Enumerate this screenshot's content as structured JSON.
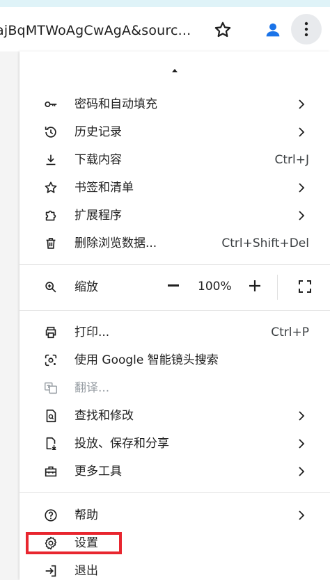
{
  "toolbar": {
    "url_text": "ajBqMTWoAgCwAgA&sourc...",
    "star_icon": "star-outline-icon",
    "profile_icon": "person-icon",
    "menu_icon": "three-dots-vertical-icon",
    "profile_color": "#1a73e8"
  },
  "menu": {
    "items": [
      {
        "label": "密码和自动填充",
        "icon": "key-icon",
        "shortcut": "",
        "has_submenu": true
      },
      {
        "label": "历史记录",
        "icon": "history-icon",
        "shortcut": "",
        "has_submenu": true
      },
      {
        "label": "下载内容",
        "icon": "download-icon",
        "shortcut": "Ctrl+J",
        "has_submenu": false
      },
      {
        "label": "书签和清单",
        "icon": "star-icon",
        "shortcut": "",
        "has_submenu": true
      },
      {
        "label": "扩展程序",
        "icon": "puzzle-icon",
        "shortcut": "",
        "has_submenu": true
      },
      {
        "label": "删除浏览数据...",
        "icon": "trash-icon",
        "shortcut": "Ctrl+Shift+Del",
        "has_submenu": false
      }
    ],
    "zoom": {
      "label": "缩放",
      "value": "100%",
      "icon": "zoom-icon"
    },
    "items2": [
      {
        "label": "打印...",
        "icon": "printer-icon",
        "shortcut": "Ctrl+P",
        "has_submenu": false
      },
      {
        "label": "使用 Google 智能镜头搜索",
        "icon": "lens-icon",
        "shortcut": "",
        "has_submenu": false
      },
      {
        "label": "翻译...",
        "icon": "translate-icon",
        "shortcut": "",
        "has_submenu": false,
        "disabled": true
      },
      {
        "label": "查找和修改",
        "icon": "find-icon",
        "shortcut": "",
        "has_submenu": true
      },
      {
        "label": "投放、保存和分享",
        "icon": "cast-save-icon",
        "shortcut": "",
        "has_submenu": true
      },
      {
        "label": "更多工具",
        "icon": "toolbox-icon",
        "shortcut": "",
        "has_submenu": true
      }
    ],
    "items3": [
      {
        "label": "帮助",
        "icon": "help-icon",
        "shortcut": "",
        "has_submenu": true
      },
      {
        "label": "设置",
        "icon": "gear-icon",
        "shortcut": "",
        "has_submenu": false
      },
      {
        "label": "退出",
        "icon": "exit-icon",
        "shortcut": "",
        "has_submenu": false
      }
    ]
  },
  "colors": {
    "highlight": "#e8262f",
    "disabled_text": "#9aa0a6"
  }
}
